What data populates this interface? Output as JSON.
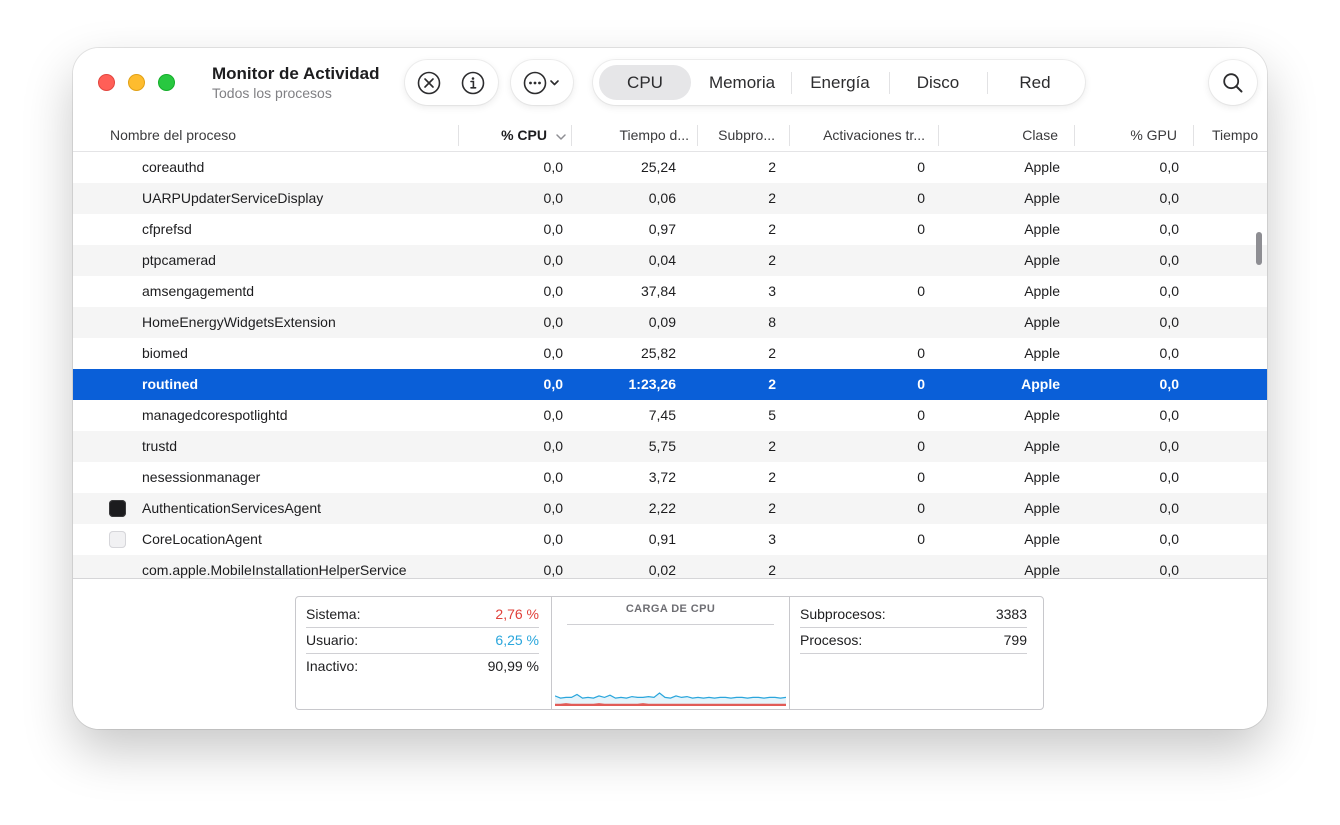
{
  "window": {
    "title": "Monitor de Actividad",
    "subtitle": "Todos los procesos"
  },
  "toolbar": {
    "stop_icon": "xmark-circle-icon",
    "info_icon": "info-circle-icon",
    "more_icon": "ellipsis-circle-icon",
    "search_icon": "magnifying-glass-icon",
    "tabs": [
      {
        "label": "CPU",
        "selected": true
      },
      {
        "label": "Memoria",
        "selected": false
      },
      {
        "label": "Energía",
        "selected": false
      },
      {
        "label": "Disco",
        "selected": false
      },
      {
        "label": "Red",
        "selected": false
      }
    ]
  },
  "table": {
    "columns": {
      "name": "Nombre del proceso",
      "cpu": "% CPU",
      "time": "Tiempo d...",
      "threads": "Subpro...",
      "wakeups": "Activaciones tr...",
      "class": "Clase",
      "gpu": "% GPU",
      "gpu_time": "Tiempo"
    },
    "sort_column": "cpu",
    "sort_direction": "descending",
    "selected_row": 7,
    "rows": [
      {
        "name": "coreauthd",
        "cpu": "0,0",
        "time": "25,24",
        "threads": "2",
        "wakeups": "0",
        "class": "Apple",
        "gpu": "0,0",
        "icon": ""
      },
      {
        "name": "UARPUpdaterServiceDisplay",
        "cpu": "0,0",
        "time": "0,06",
        "threads": "2",
        "wakeups": "0",
        "class": "Apple",
        "gpu": "0,0",
        "icon": ""
      },
      {
        "name": "cfprefsd",
        "cpu": "0,0",
        "time": "0,97",
        "threads": "2",
        "wakeups": "0",
        "class": "Apple",
        "gpu": "0,0",
        "icon": ""
      },
      {
        "name": "ptpcamerad",
        "cpu": "0,0",
        "time": "0,04",
        "threads": "2",
        "wakeups": "",
        "class": "Apple",
        "gpu": "0,0",
        "icon": ""
      },
      {
        "name": "amsengagementd",
        "cpu": "0,0",
        "time": "37,84",
        "threads": "3",
        "wakeups": "0",
        "class": "Apple",
        "gpu": "0,0",
        "icon": ""
      },
      {
        "name": "HomeEnergyWidgetsExtension",
        "cpu": "0,0",
        "time": "0,09",
        "threads": "8",
        "wakeups": "",
        "class": "Apple",
        "gpu": "0,0",
        "icon": ""
      },
      {
        "name": "biomed",
        "cpu": "0,0",
        "time": "25,82",
        "threads": "2",
        "wakeups": "0",
        "class": "Apple",
        "gpu": "0,0",
        "icon": ""
      },
      {
        "name": "routined",
        "cpu": "0,0",
        "time": "1:23,26",
        "threads": "2",
        "wakeups": "0",
        "class": "Apple",
        "gpu": "0,0",
        "icon": ""
      },
      {
        "name": "managedcorespotlightd",
        "cpu": "0,0",
        "time": "7,45",
        "threads": "5",
        "wakeups": "0",
        "class": "Apple",
        "gpu": "0,0",
        "icon": ""
      },
      {
        "name": "trustd",
        "cpu": "0,0",
        "time": "5,75",
        "threads": "2",
        "wakeups": "0",
        "class": "Apple",
        "gpu": "0,0",
        "icon": ""
      },
      {
        "name": "nesessionmanager",
        "cpu": "0,0",
        "time": "3,72",
        "threads": "2",
        "wakeups": "0",
        "class": "Apple",
        "gpu": "0,0",
        "icon": ""
      },
      {
        "name": "AuthenticationServicesAgent",
        "cpu": "0,0",
        "time": "2,22",
        "threads": "2",
        "wakeups": "0",
        "class": "Apple",
        "gpu": "0,0",
        "icon": "dark-app-icon"
      },
      {
        "name": "CoreLocationAgent",
        "cpu": "0,0",
        "time": "0,91",
        "threads": "3",
        "wakeups": "0",
        "class": "Apple",
        "gpu": "0,0",
        "icon": "generic-app-icon"
      },
      {
        "name": "com.apple.MobileInstallationHelperService",
        "cpu": "0,0",
        "time": "0,02",
        "threads": "2",
        "wakeups": "",
        "class": "Apple",
        "gpu": "0,0",
        "icon": ""
      }
    ]
  },
  "summary": {
    "sistema_label": "Sistema:",
    "sistema_value": "2,76 %",
    "usuario_label": "Usuario:",
    "usuario_value": "6,25 %",
    "inactivo_label": "Inactivo:",
    "inactivo_value": "90,99 %",
    "chart_title": "CARGA DE CPU",
    "subprocesos_label": "Subprocesos:",
    "subprocesos_value": "3383",
    "procesos_label": "Procesos:",
    "procesos_value": "799"
  },
  "colors": {
    "selection": "#0a5fd8",
    "system_load": "#e0403a",
    "user_load": "#2aa6dc",
    "close": "#ff5f57",
    "minimize": "#febc2e",
    "zoom": "#28c840"
  },
  "chart_data": {
    "type": "area",
    "title": "CARGA DE CPU",
    "ylim": [
      0,
      100
    ],
    "series": [
      {
        "name": "Sistema",
        "color": "#e0403a",
        "values": [
          3,
          3,
          4,
          3,
          3,
          3,
          3,
          3,
          4,
          3,
          3,
          3,
          3,
          3,
          3,
          3,
          4,
          3,
          3,
          3,
          3,
          3,
          3,
          3,
          3,
          3,
          3,
          3,
          3,
          3,
          3,
          3,
          3,
          3,
          3,
          3,
          3,
          3,
          3,
          3,
          3,
          3,
          3
        ]
      },
      {
        "name": "Usuario",
        "color": "#2aa6dc",
        "values": [
          11,
          8,
          8,
          9,
          13,
          8,
          9,
          8,
          10,
          9,
          12,
          8,
          9,
          8,
          10,
          9,
          8,
          10,
          9,
          15,
          9,
          8,
          11,
          9,
          10,
          8,
          9,
          8,
          9,
          8,
          9,
          9,
          8,
          9,
          9,
          8,
          9,
          9,
          8,
          9,
          9,
          8,
          9
        ]
      }
    ]
  }
}
